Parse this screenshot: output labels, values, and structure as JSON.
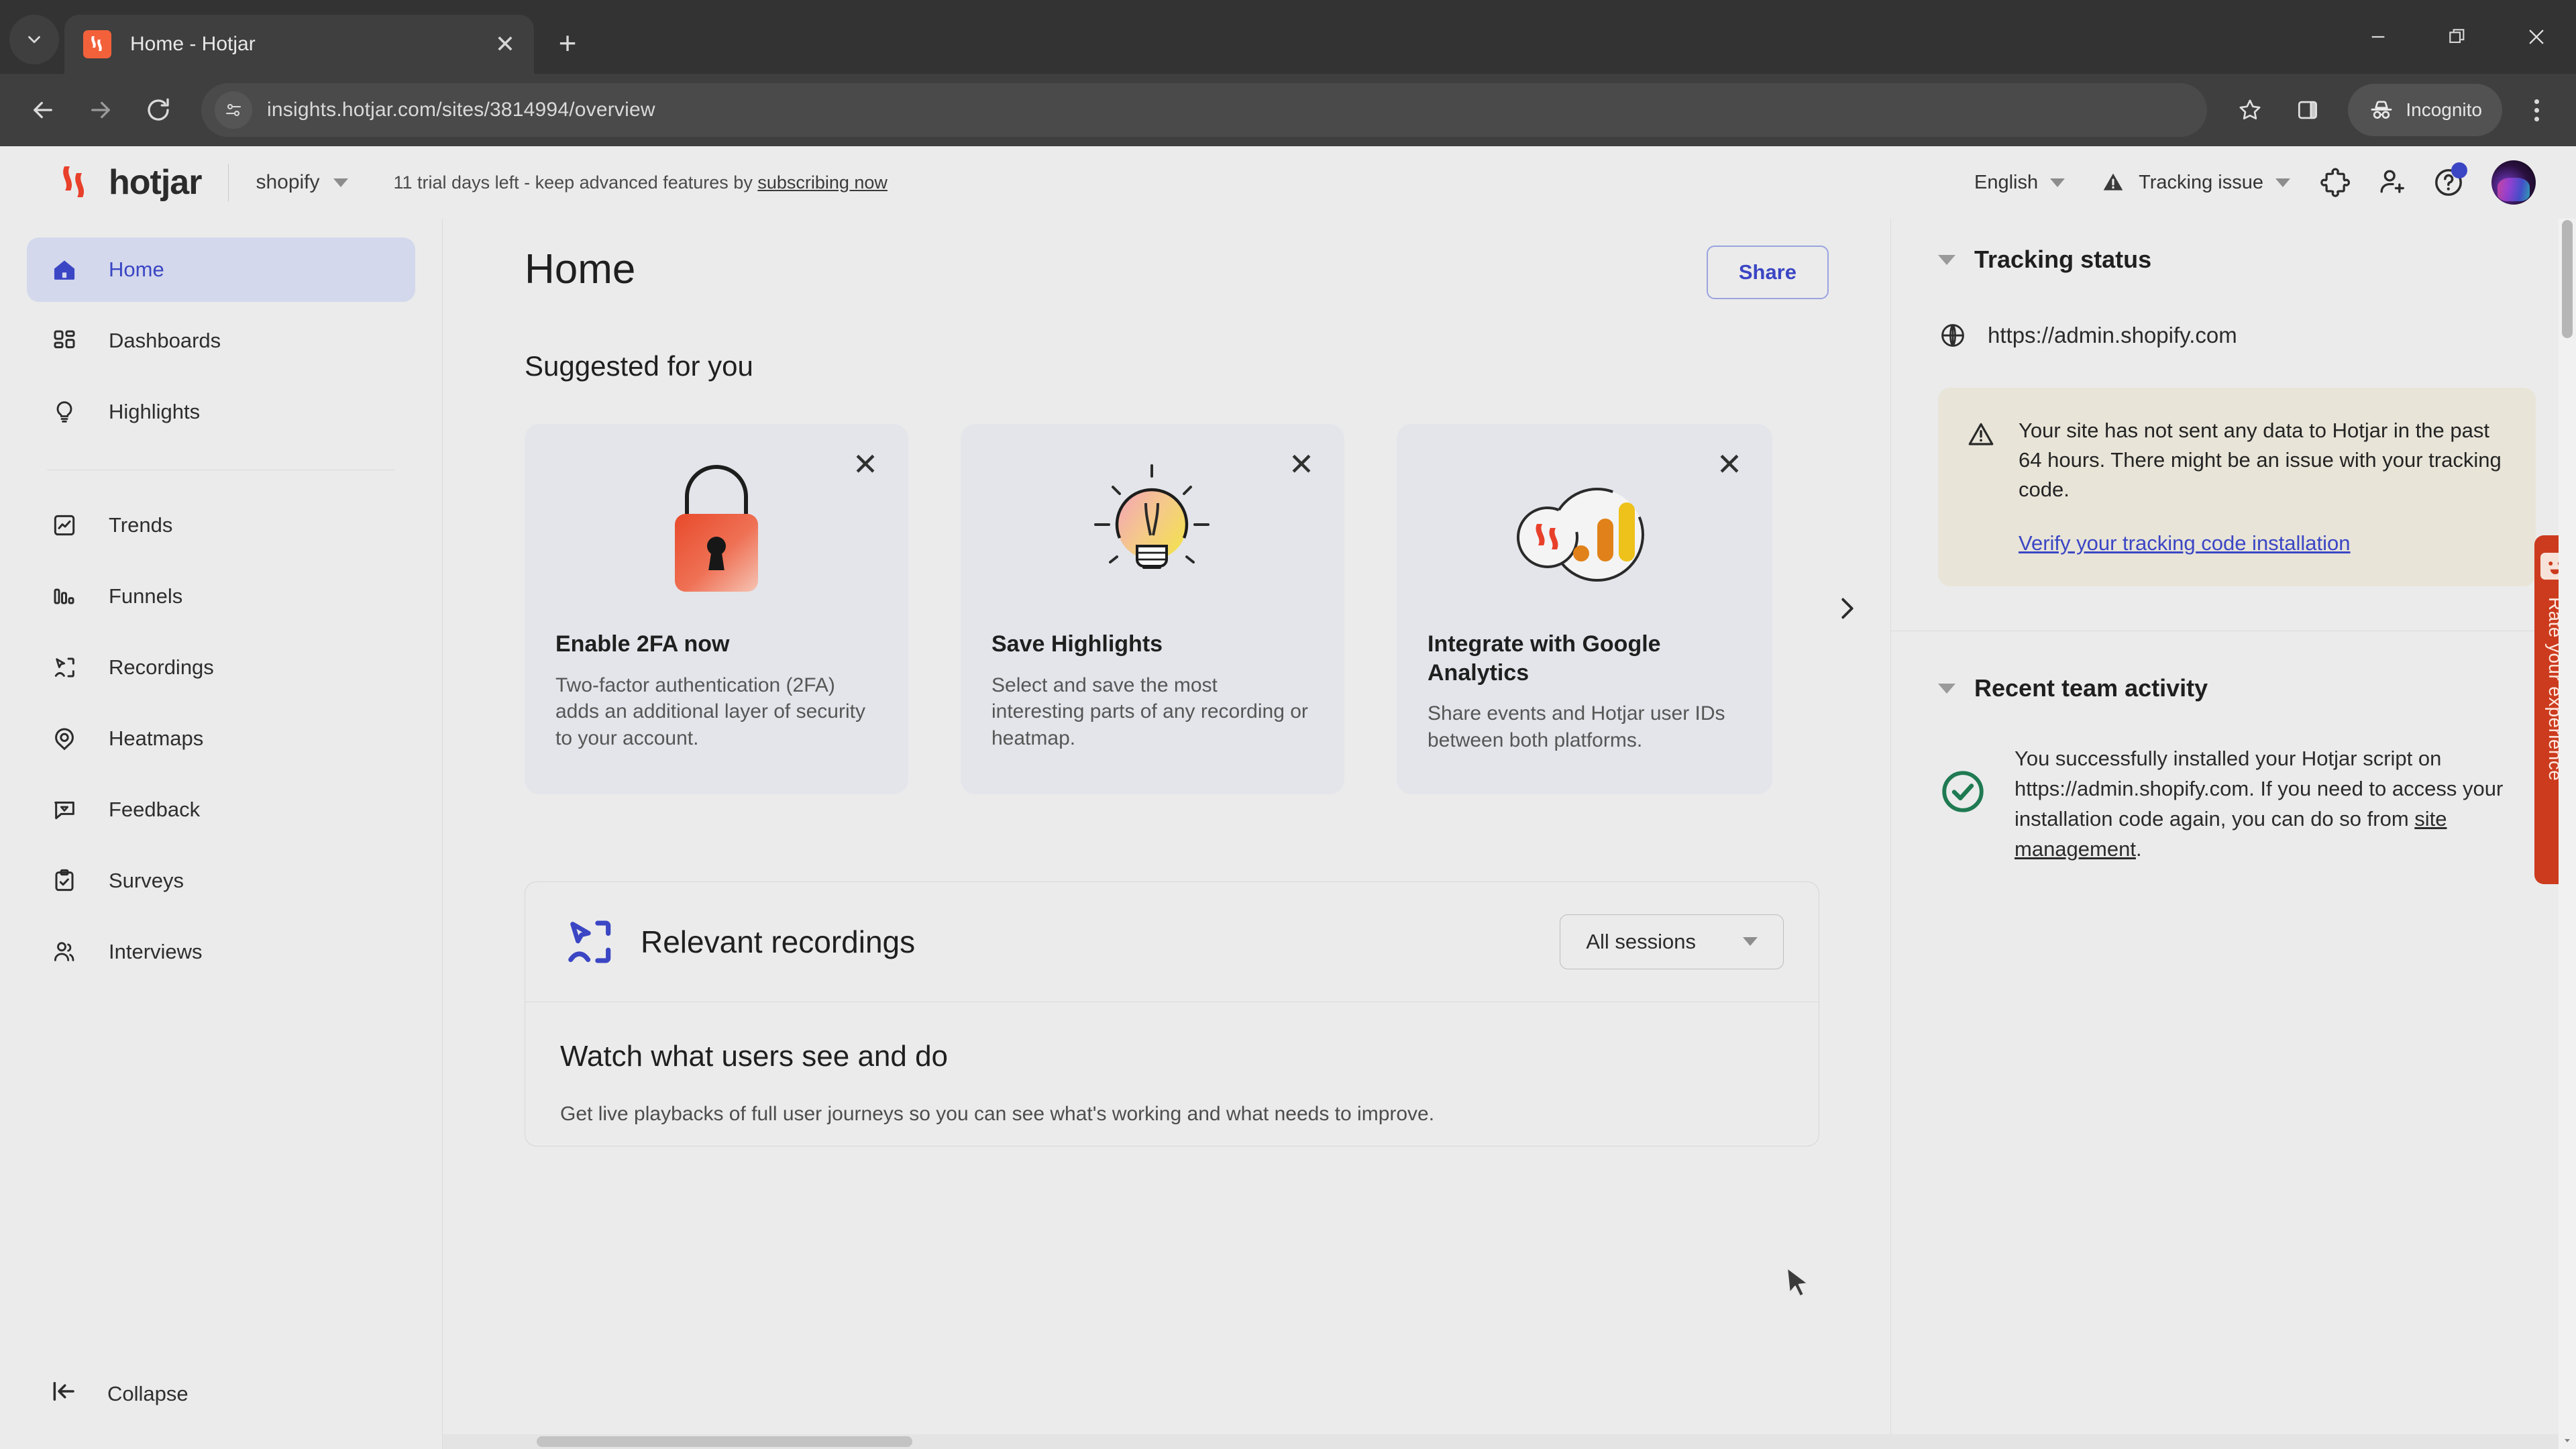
{
  "browser": {
    "tab": {
      "title": "Home - Hotjar",
      "favicon": "hotjar-favicon"
    },
    "tab_search_icon": "chevron-down-icon",
    "new_tab_label": "+",
    "window_controls": {
      "minimize": "minimize-icon",
      "maximize": "maximize-icon",
      "close": "close-icon"
    },
    "nav": {
      "back": "back-arrow-icon",
      "forward": "forward-arrow-icon",
      "reload": "reload-icon"
    },
    "omnibox": {
      "url": "insights.hotjar.com/sites/3814994/overview",
      "site_info_icon": "page-settings-icon"
    },
    "actions": {
      "bookmark": "star-icon",
      "side_panel": "side-panel-icon",
      "incognito_label": "Incognito",
      "incognito_icon": "incognito-icon",
      "menu": "three-dots-menu-icon"
    }
  },
  "app_header": {
    "brand": "hotjar",
    "site_name": "shopify",
    "trial_text": "11 trial days left - keep advanced features by ",
    "trial_link": "subscribing now",
    "language": "English",
    "tracking_issue": "Tracking issue",
    "icons": {
      "integrations": "puzzle-piece-icon",
      "invite": "add-user-icon",
      "help": "help-circle-icon"
    }
  },
  "sidebar": {
    "primary": [
      {
        "label": "Home",
        "icon": "home-icon",
        "active": true
      },
      {
        "label": "Dashboards",
        "icon": "dashboards-grid-icon",
        "active": false
      },
      {
        "label": "Highlights",
        "icon": "lightbulb-icon",
        "active": false
      }
    ],
    "secondary": [
      {
        "label": "Trends",
        "icon": "trends-chart-icon"
      },
      {
        "label": "Funnels",
        "icon": "funnels-bars-icon"
      },
      {
        "label": "Recordings",
        "icon": "recordings-cursor-icon"
      },
      {
        "label": "Heatmaps",
        "icon": "heatmap-pin-icon"
      },
      {
        "label": "Feedback",
        "icon": "feedback-bubble-icon"
      },
      {
        "label": "Surveys",
        "icon": "surveys-clipboard-icon"
      },
      {
        "label": "Interviews",
        "icon": "interviews-people-icon"
      }
    ],
    "collapse": {
      "label": "Collapse",
      "icon": "collapse-left-icon"
    }
  },
  "main": {
    "page_title": "Home",
    "share_label": "Share",
    "suggested_heading": "Suggested for you",
    "cards": [
      {
        "title": "Enable 2FA now",
        "desc": "Two-factor authentication (2FA) adds an additional layer of security to your account.",
        "art": "padlock-illustration"
      },
      {
        "title": "Save Highlights",
        "desc": "Select and save the most interesting parts of any recording or heatmap.",
        "art": "lightbulb-illustration"
      },
      {
        "title": "Integrate with Google Analytics",
        "desc": "Share events and Hotjar user IDs between both platforms.",
        "art": "hotjar-ga-venn-illustration"
      }
    ],
    "carousel_next_icon": "chevron-right-icon",
    "recordings": {
      "title": "Relevant recordings",
      "logo_icon": "recordings-cursor-icon",
      "filter_value": "All sessions",
      "empty_heading": "Watch what users see and do",
      "empty_desc": "Get live playbacks of full user journeys so you can see what's working and what needs to improve."
    }
  },
  "rightbar": {
    "tracking_status": {
      "heading": "Tracking status",
      "site_url": "https://admin.shopify.com",
      "globe_icon": "globe-icon",
      "warning_icon": "warning-triangle-icon",
      "warning_text": "Your site has not sent any data to Hotjar in the past 64 hours. There might be an issue with your tracking code.",
      "warning_link": "Verify your tracking code installation"
    },
    "recent_activity": {
      "heading": "Recent team activity",
      "status_icon": "check-circle-icon",
      "text_before": "You successfully installed your Hotjar script on https://admin.shopify.com. If you need to access your installation code again, you can do so from ",
      "link": "site management",
      "text_after": "."
    }
  },
  "rate_widget": {
    "label": "Rate your experience",
    "icon": "smiley-face-icon"
  },
  "colors": {
    "accent_blue": "#3b46c4",
    "hotjar_red": "#f3613a",
    "rate_tab_red": "#cc3b1e",
    "warning_bg": "#e8e4d8",
    "app_bg": "#ebebeb",
    "chrome_bg": "#333333",
    "success_green": "#1f7a52"
  }
}
